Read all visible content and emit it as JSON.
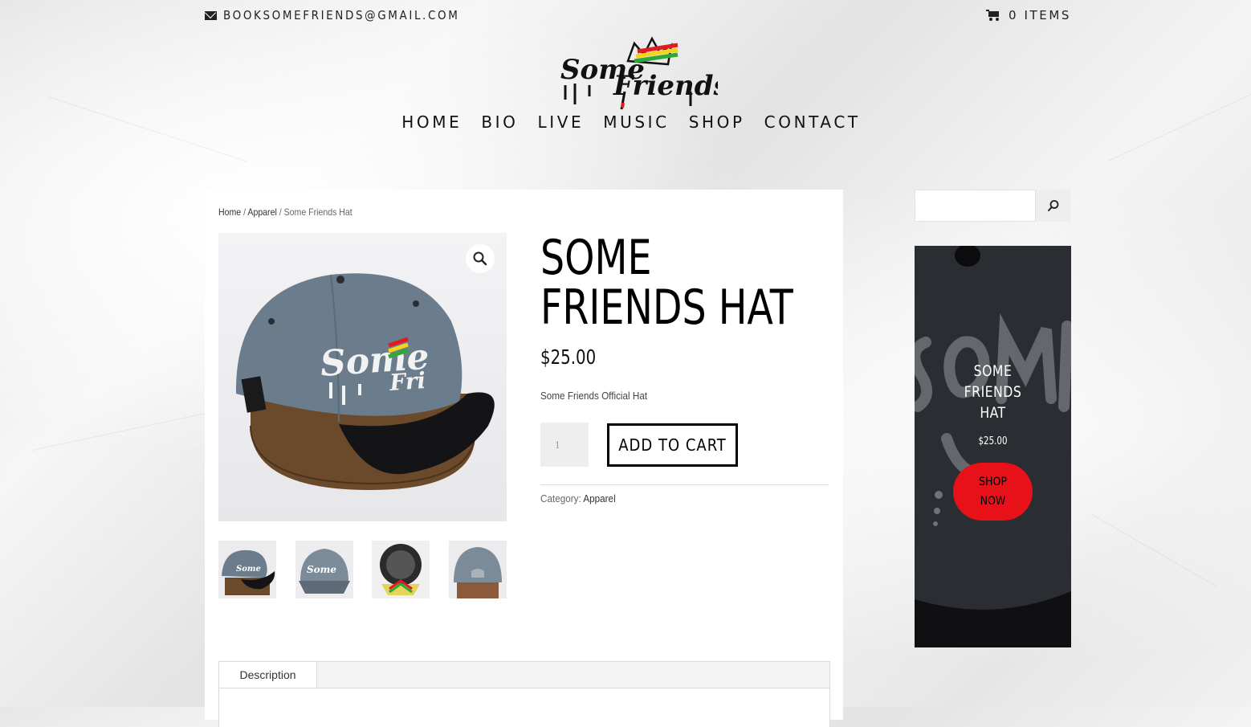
{
  "topbar": {
    "email": "BOOKSOMEFRIENDS@GMAIL.COM",
    "cart_label": "0 ITEMS"
  },
  "logo": {
    "text_line1": "Some",
    "text_line2": "Friends"
  },
  "nav": {
    "items": [
      {
        "label": "HOME"
      },
      {
        "label": "BIO"
      },
      {
        "label": "LIVE"
      },
      {
        "label": "MUSIC"
      },
      {
        "label": "SHOP"
      },
      {
        "label": "CONTACT"
      }
    ]
  },
  "breadcrumb": {
    "home": "Home",
    "sep1": " / ",
    "category": "Apparel",
    "sep2": " / ",
    "current": "Some Friends Hat"
  },
  "product": {
    "title": "SOME FRIENDS HAT",
    "price": "$25.00",
    "short_description": "Some Friends Official Hat",
    "quantity": "1",
    "add_to_cart_label": "ADD TO CART",
    "category_label": "Category: ",
    "category_value": "Apparel",
    "image_count": 4
  },
  "tabs": {
    "items": [
      {
        "label": "Description"
      }
    ]
  },
  "sidebar": {
    "search": {
      "placeholder": "",
      "value": ""
    },
    "promo": {
      "title": "SOME\nFRIENDS\nHAT",
      "price": "$25.00",
      "button_label": "SHOP\nNOW"
    }
  },
  "colors": {
    "shop_now_button": "#e8111a",
    "hat_crown": "#6b7c8c",
    "hat_brim": "#141416",
    "promo_bg": "#26292c",
    "logo_red": "#e11b22",
    "logo_yellow": "#f5d21b",
    "logo_green": "#2ea836"
  }
}
